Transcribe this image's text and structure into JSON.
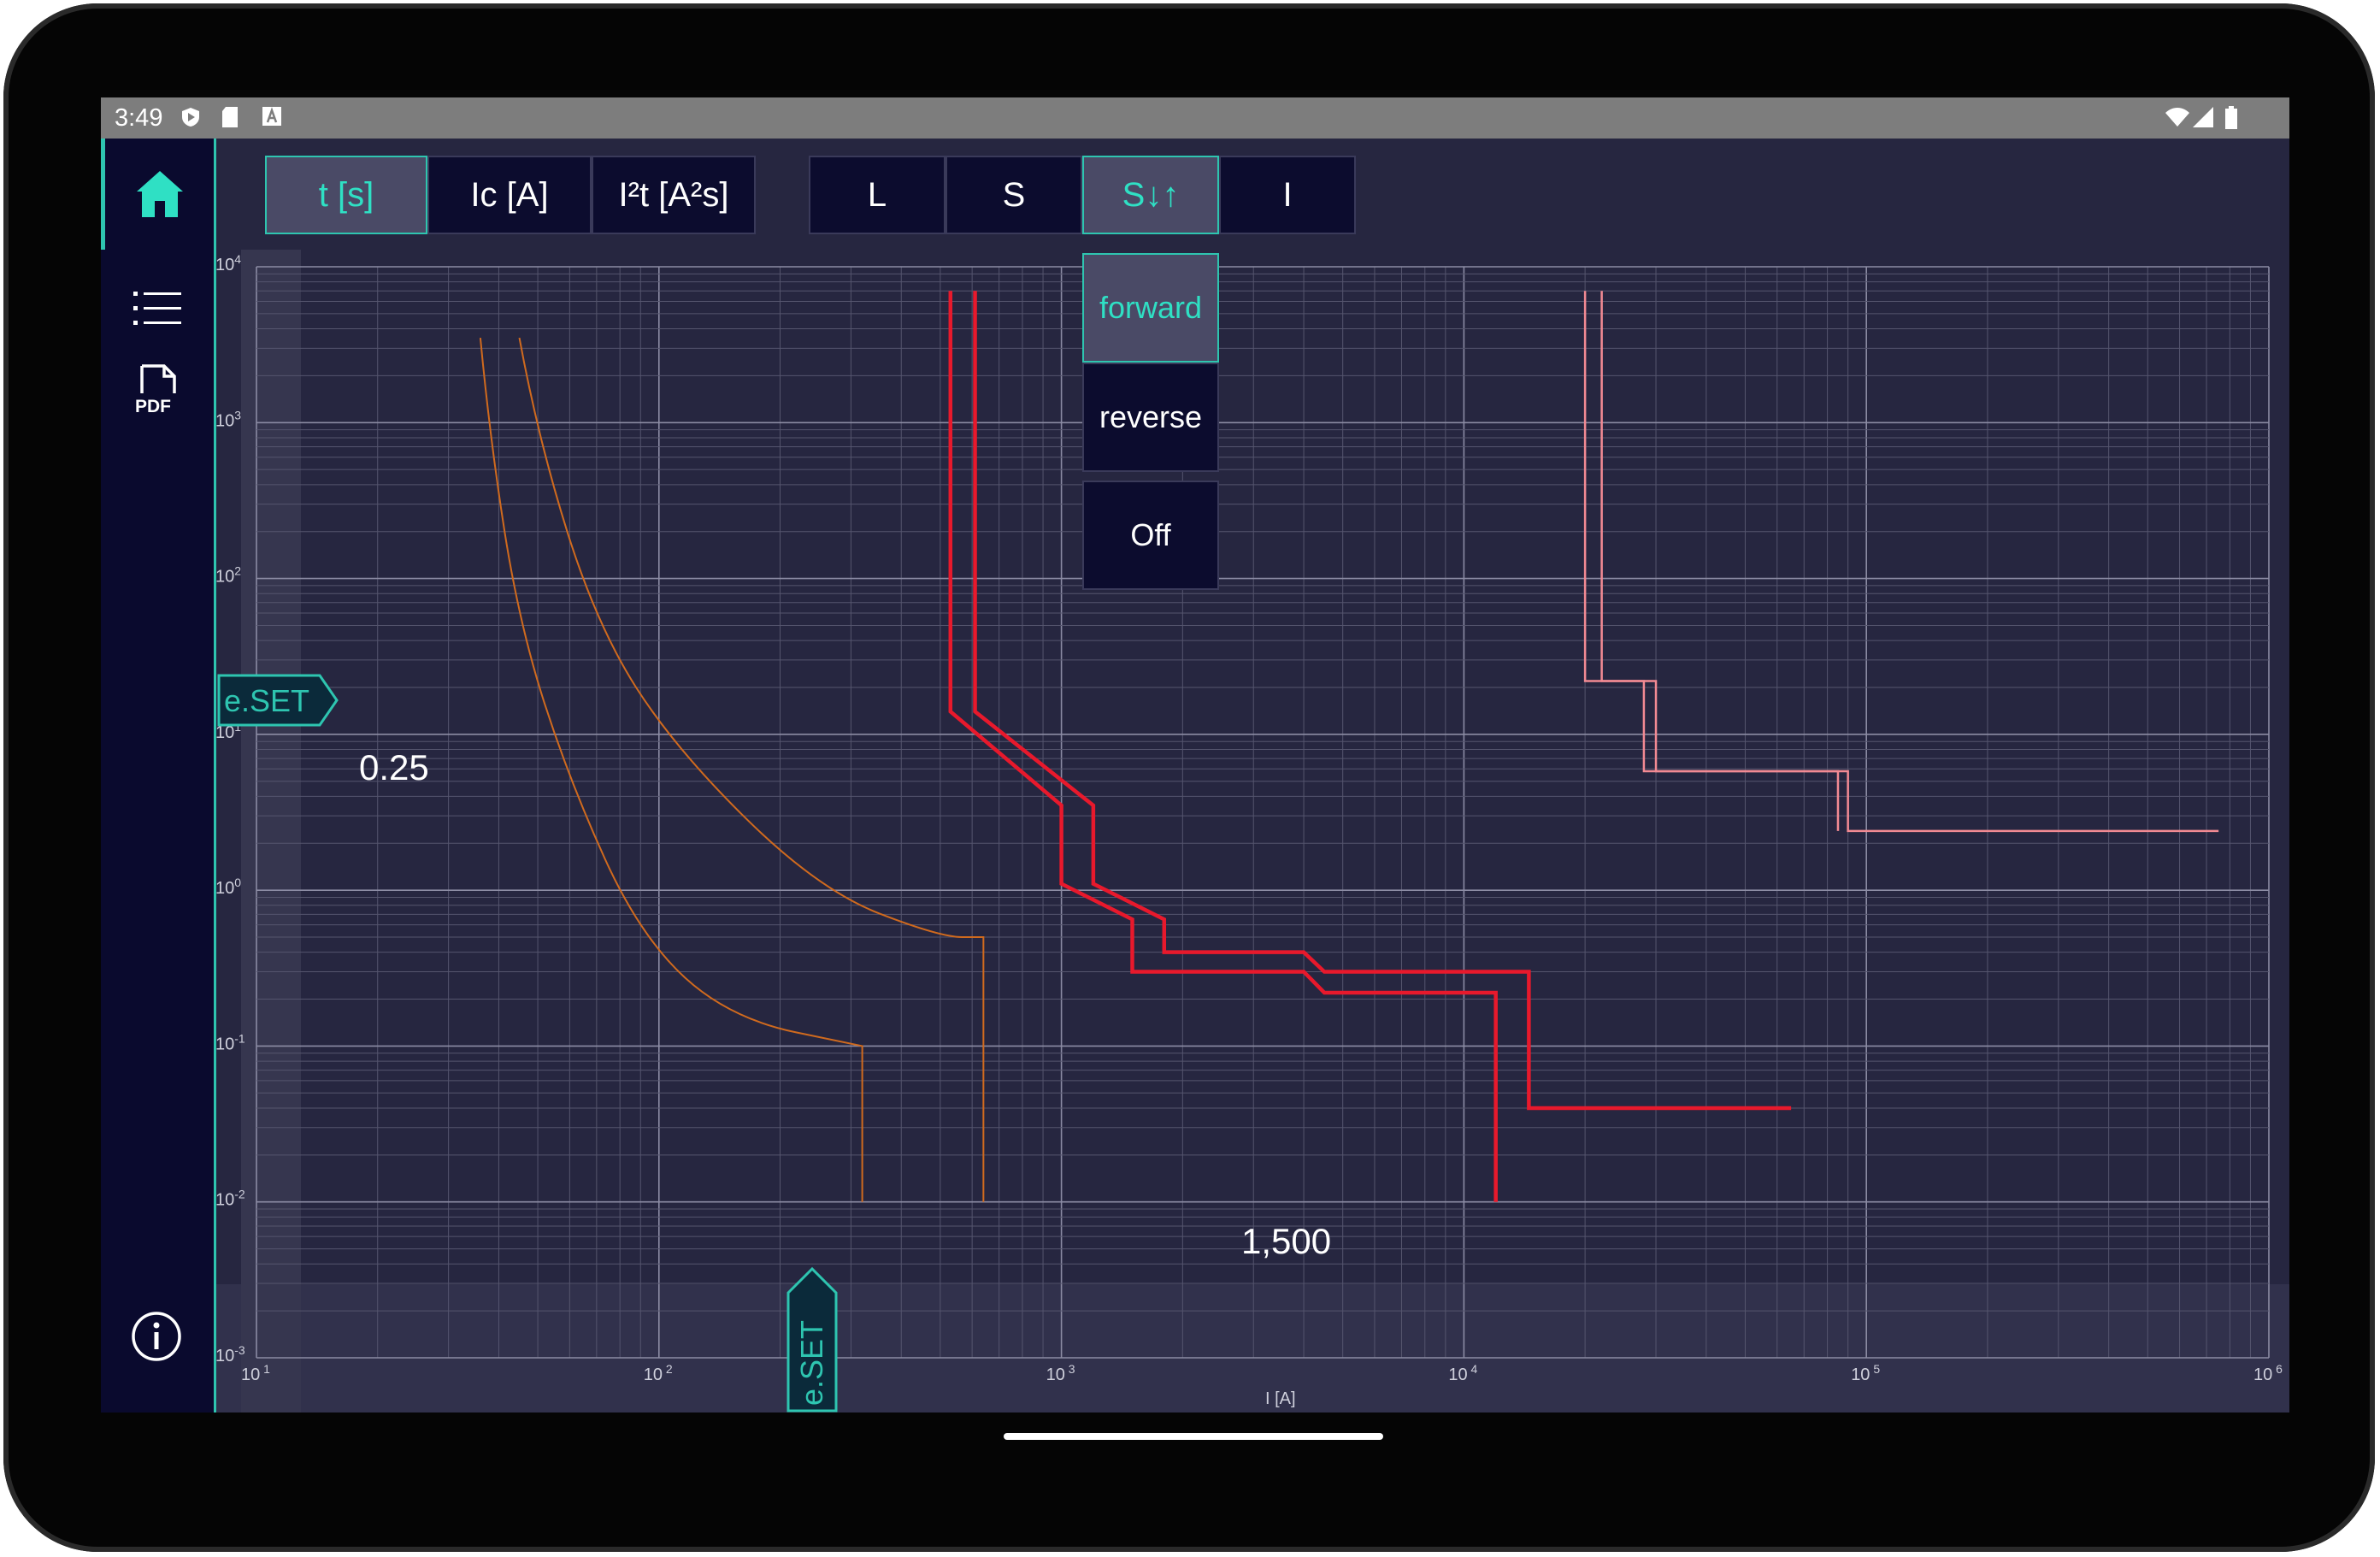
{
  "status_bar": {
    "time": "3:49"
  },
  "toolbar": {
    "view_buttons": [
      {
        "label": "t [s]",
        "active": true
      },
      {
        "label": "Ic [A]",
        "active": false
      },
      {
        "label": "I²t [A²s]",
        "active": false
      }
    ],
    "protection_buttons": [
      {
        "label": "L",
        "active": false
      },
      {
        "label": "S",
        "active": false
      },
      {
        "label": "S↓↑",
        "active": true
      },
      {
        "label": "I",
        "active": false
      }
    ]
  },
  "dropdown": {
    "items": [
      {
        "label": "forward",
        "active": true
      },
      {
        "label": "reverse",
        "active": false
      },
      {
        "label": "Off",
        "active": false
      }
    ]
  },
  "sidebar": {
    "pdf_label": "PDF"
  },
  "chart": {
    "xlabel": "I [A]",
    "y_value_label": "0.25",
    "x_value_label": "1,500",
    "eset_label": "e.SET",
    "x_ticks": [
      {
        "base": "10",
        "exp": "1"
      },
      {
        "base": "10",
        "exp": "2"
      },
      {
        "base": "10",
        "exp": "3"
      },
      {
        "base": "10",
        "exp": "4"
      },
      {
        "base": "10",
        "exp": "5"
      },
      {
        "base": "10",
        "exp": "6"
      }
    ],
    "y_ticks": [
      {
        "base": "10",
        "exp": "4"
      },
      {
        "base": "10",
        "exp": "3"
      },
      {
        "base": "10",
        "exp": "2"
      },
      {
        "base": "10",
        "exp": "1"
      },
      {
        "base": "10",
        "exp": "0"
      },
      {
        "base": "10",
        "exp": "-1"
      },
      {
        "base": "10",
        "exp": "-2"
      },
      {
        "base": "10",
        "exp": "-3"
      }
    ]
  },
  "colors": {
    "accent": "#2ec5b0",
    "orange_curve": "#d06a1e",
    "red_curve": "#e8192c",
    "pink_curve": "#f28a93",
    "background": "#262640"
  },
  "chart_data": {
    "type": "line",
    "x_scale": "log",
    "y_scale": "log",
    "xlim": [
      10,
      1000000
    ],
    "ylim": [
      0.001,
      10000
    ],
    "xlabel": "I [A]",
    "series": [
      {
        "values": [
          [
            36,
            3500
          ],
          [
            38,
            800
          ],
          [
            45,
            50
          ],
          [
            60,
            5
          ],
          [
            90,
            0.5
          ],
          [
            150,
            0.15
          ],
          [
            320,
            0.1
          ],
          [
            320,
            0.01
          ]
        ]
      },
      {
        "values": [
          [
            45,
            3500
          ],
          [
            50,
            800
          ],
          [
            70,
            50
          ],
          [
            110,
            8
          ],
          [
            250,
            1
          ],
          [
            500,
            0.5
          ],
          [
            640,
            0.5
          ],
          [
            640,
            0.01
          ]
        ]
      },
      {
        "values": [
          [
            530,
            7000
          ],
          [
            530,
            14
          ],
          [
            1000,
            3.5
          ],
          [
            1000,
            1.1
          ],
          [
            1500,
            0.65
          ],
          [
            1500,
            0.3
          ],
          [
            4000,
            0.3
          ],
          [
            4500,
            0.22
          ],
          [
            12000,
            0.22
          ],
          [
            12000,
            0.01
          ]
        ]
      },
      {
        "values": [
          [
            610,
            7000
          ],
          [
            610,
            14
          ],
          [
            1200,
            3.5
          ],
          [
            1200,
            1.1
          ],
          [
            1800,
            0.65
          ],
          [
            1800,
            0.4
          ],
          [
            4000,
            0.4
          ],
          [
            4500,
            0.3
          ],
          [
            14500,
            0.3
          ],
          [
            14500,
            0.04
          ],
          [
            65000,
            0.04
          ]
        ]
      },
      {
        "values": [
          [
            20000,
            7000
          ],
          [
            20000,
            22
          ],
          [
            30000,
            22
          ],
          [
            30000,
            5.8
          ],
          [
            90000,
            5.8
          ],
          [
            90000,
            2.4
          ],
          [
            750000,
            2.4
          ]
        ]
      },
      {
        "values": [
          [
            22000,
            7000
          ],
          [
            22000,
            22
          ],
          [
            28000,
            22
          ],
          [
            28000,
            5.8
          ],
          [
            85000,
            5.8
          ],
          [
            85000,
            2.4
          ]
        ]
      }
    ]
  }
}
